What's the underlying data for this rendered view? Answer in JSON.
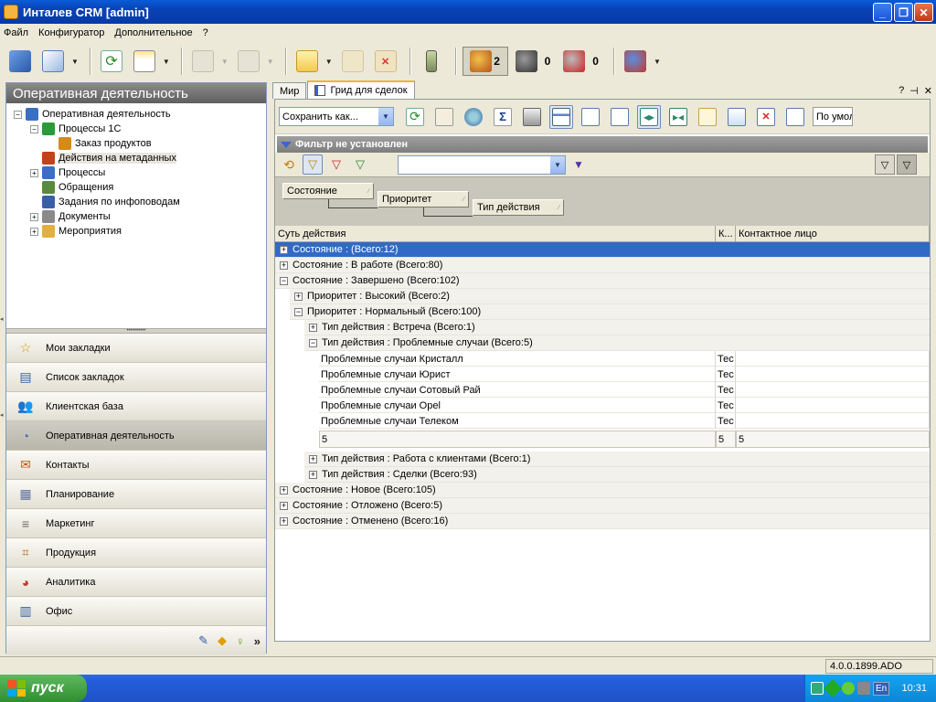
{
  "window": {
    "title": "Инталев CRM [admin]"
  },
  "menu": [
    "Файл",
    "Конфигуратор",
    "Дополнительное",
    "?"
  ],
  "toolbar": {
    "counts": {
      "users_active": "2",
      "users_warn": "0",
      "users_blocked": "0"
    }
  },
  "left_panel": {
    "header": "Оперативная деятельность",
    "tree": [
      {
        "label": "Оперативная деятельность",
        "level": 0,
        "expander": "−",
        "icon": "operations-icon"
      },
      {
        "label": "Процессы 1С",
        "level": 1,
        "expander": "−",
        "icon": "play-process-icon"
      },
      {
        "label": "Заказ продуктов",
        "level": 2,
        "expander": "",
        "icon": "order-icon"
      },
      {
        "label": "Действия на метаданных",
        "level": 1,
        "expander": "",
        "icon": "metadata-actions-icon",
        "selected": true
      },
      {
        "label": "Процессы",
        "level": 1,
        "expander": "+",
        "icon": "processes-icon"
      },
      {
        "label": "Обращения",
        "level": 1,
        "expander": "",
        "icon": "requests-icon"
      },
      {
        "label": "Задания по инфоповодам",
        "level": 1,
        "expander": "",
        "icon": "tasks-icon"
      },
      {
        "label": "Документы",
        "level": 1,
        "expander": "+",
        "icon": "documents-icon"
      },
      {
        "label": "Мероприятия",
        "level": 1,
        "expander": "+",
        "icon": "events-folder-icon"
      }
    ],
    "nav": [
      {
        "label": "Мои закладки",
        "icon": "star-icon",
        "glyph": "☆",
        "color": "#d4a40b"
      },
      {
        "label": "Список закладок",
        "icon": "bookmark-list-icon",
        "glyph": "▤",
        "color": "#3a5fa8"
      },
      {
        "label": "Клиентская база",
        "icon": "clients-icon",
        "glyph": "👥",
        "color": "#b35a1f"
      },
      {
        "label": "Оперативная деятельность",
        "icon": "operations-icon",
        "glyph": "◔",
        "color": "#3a6fc4",
        "active": true
      },
      {
        "label": "Контакты",
        "icon": "contacts-icon",
        "glyph": "✉",
        "color": "#c0561b"
      },
      {
        "label": "Планирование",
        "icon": "calendar-icon",
        "glyph": "▦",
        "color": "#5c6f9c"
      },
      {
        "label": "Маркетинг",
        "icon": "marketing-icon",
        "glyph": "≡",
        "color": "#6b6b6b"
      },
      {
        "label": "Продукция",
        "icon": "products-icon",
        "glyph": "⌗",
        "color": "#b06a1a"
      },
      {
        "label": "Аналитика",
        "icon": "analytics-pie-icon",
        "glyph": "◕",
        "color": "#c43a2f"
      },
      {
        "label": "Офис",
        "icon": "office-icon",
        "glyph": "▥",
        "color": "#36609e"
      }
    ]
  },
  "tabs": [
    {
      "label": "Мир",
      "active": false
    },
    {
      "label": "Грид для сделок",
      "active": true
    }
  ],
  "grid_toolbar": {
    "save_as": "Сохранить как...",
    "sort_default": "По умол"
  },
  "filter": {
    "status": "Фильтр не установлен",
    "combo_value": ""
  },
  "group_by": [
    "Состояние",
    "Приоритет",
    "Тип действия"
  ],
  "columns": [
    "Суть действия",
    "К...",
    "Контактное лицо"
  ],
  "rows": [
    {
      "label": "Состояние :  (Всего:12)",
      "depth": 0,
      "pm": "+",
      "selected": true
    },
    {
      "label": "Состояние : В работе  (Всего:80)",
      "depth": 0,
      "pm": "+"
    },
    {
      "label": "Состояние : Завершено  (Всего:102)",
      "depth": 0,
      "pm": "−"
    },
    {
      "label": "Приоритет : Высокий  (Всего:2)",
      "depth": 1,
      "pm": "+"
    },
    {
      "label": "Приоритет : Нормальный  (Всего:100)",
      "depth": 1,
      "pm": "−"
    },
    {
      "label": "Тип действия : Встреча  (Всего:1)",
      "depth": 2,
      "pm": "+"
    },
    {
      "label": "Тип действия : Проблемные случаи  (Всего:5)",
      "depth": 2,
      "pm": "−"
    }
  ],
  "data_rows": [
    {
      "action": "Проблемные случаи Кристалл",
      "k": "Тес",
      "contact": ""
    },
    {
      "action": "Проблемные случаи Юрист",
      "k": "Тес",
      "contact": ""
    },
    {
      "action": "Проблемные случаи Сотовый Рай",
      "k": "Тес",
      "contact": ""
    },
    {
      "action": "Проблемные случаи Opel",
      "k": "Тес",
      "contact": ""
    },
    {
      "action": "Проблемные случаи Телеком",
      "k": "Тес",
      "contact": ""
    }
  ],
  "summary": {
    "action": "5",
    "k": "5",
    "contact": "5"
  },
  "rows_after": [
    {
      "label": "Тип действия : Работа с клиентами  (Всего:1)",
      "depth": 2,
      "pm": "+"
    },
    {
      "label": "Тип действия : Сделки  (Всего:93)",
      "depth": 2,
      "pm": "+"
    },
    {
      "label": "Состояние : Новое  (Всего:105)",
      "depth": 0,
      "pm": "+"
    },
    {
      "label": "Состояние : Отложено  (Всего:5)",
      "depth": 0,
      "pm": "+"
    },
    {
      "label": "Состояние : Отменено  (Всего:16)",
      "depth": 0,
      "pm": "+"
    }
  ],
  "statusbar": {
    "version": "4.0.0.1899.ADO"
  },
  "taskbar": {
    "start": "пуск",
    "lang": "En",
    "clock": "10:31"
  },
  "colors": {
    "accent": "#316ac5",
    "titlebar": "#0842b4",
    "start": "#2f8f30"
  }
}
